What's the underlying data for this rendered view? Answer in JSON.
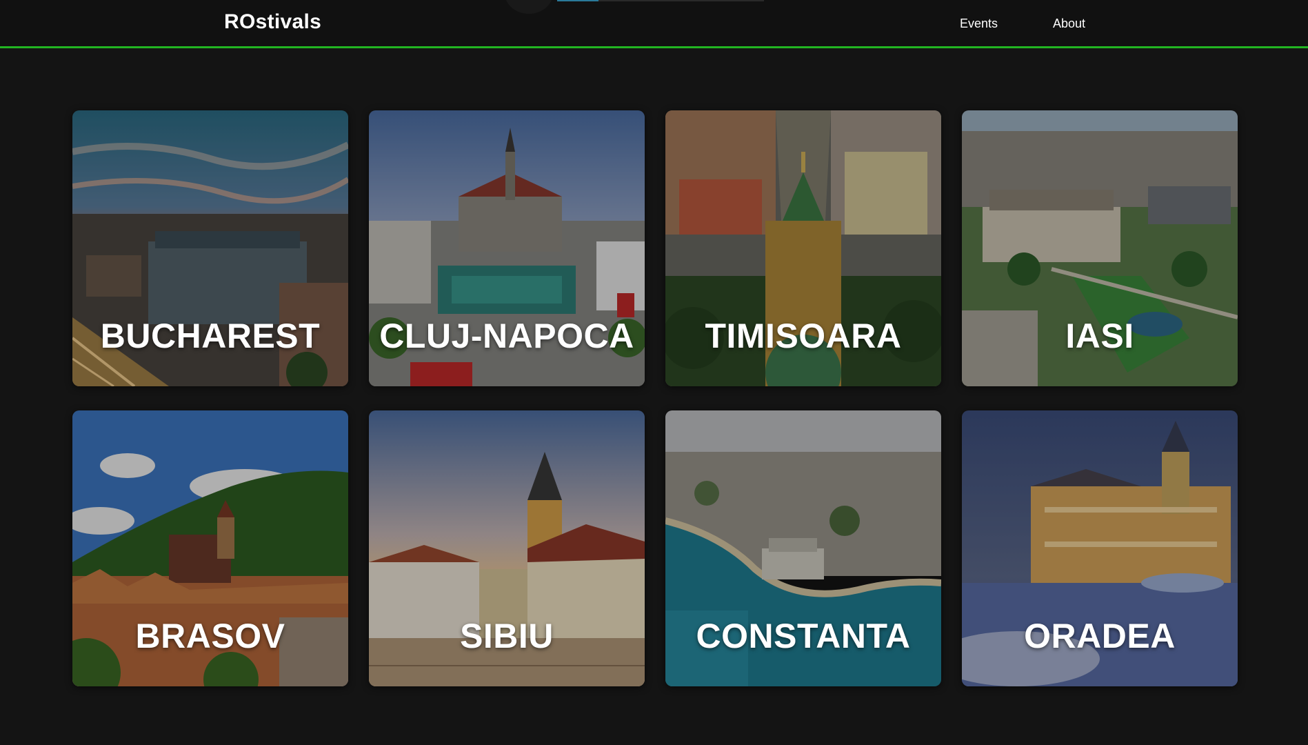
{
  "navbar": {
    "brand": "ROstivals",
    "links": [
      "Events",
      "About"
    ]
  },
  "cities": [
    {
      "name": "BUCHAREST",
      "image": "bucharest-sunset-cityscape"
    },
    {
      "name": "CLUJ-NAPOCA",
      "image": "cluj-church-square"
    },
    {
      "name": "TIMISOARA",
      "image": "timisoara-cathedral-aerial"
    },
    {
      "name": "IASI",
      "image": "iasi-palace-aerial"
    },
    {
      "name": "BRASOV",
      "image": "brasov-mountain-old-town"
    },
    {
      "name": "SIBIU",
      "image": "sibiu-square-tower"
    },
    {
      "name": "CONSTANTA",
      "image": "constanta-sea-casino"
    },
    {
      "name": "ORADEA",
      "image": "oradea-palace-night"
    }
  ],
  "colors": {
    "background": "#141414",
    "navbar": "#111111",
    "accent_line": "#22b522",
    "text": "#ffffff"
  }
}
